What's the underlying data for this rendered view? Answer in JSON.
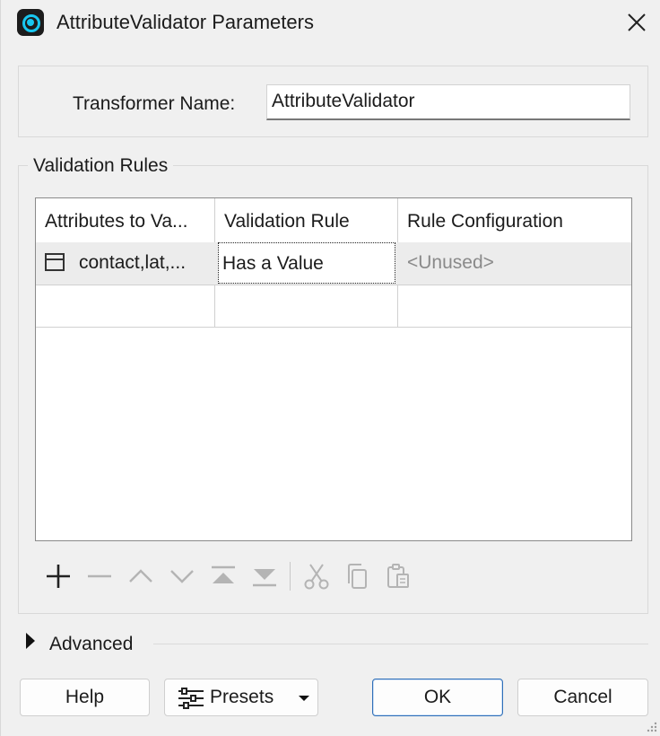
{
  "window": {
    "title": "AttributeValidator Parameters",
    "app_icon": "fme-logo-icon",
    "close_icon": "close-icon"
  },
  "transformer": {
    "label": "Transformer Name:",
    "value": "AttributeValidator"
  },
  "validation_rules": {
    "legend": "Validation Rules",
    "columns": [
      "Attributes to Va...",
      "Validation Rule",
      "Rule Configuration"
    ],
    "rows": [
      {
        "attributes": "contact,lat,...",
        "attributes_icon": "attribute-list-icon",
        "rule": "Has a Value",
        "configuration": "<Unused>"
      },
      {
        "attributes": "",
        "rule": "",
        "configuration": ""
      }
    ],
    "toolbar": [
      {
        "icon": "add-icon",
        "enabled": true
      },
      {
        "icon": "remove-icon",
        "enabled": false
      },
      {
        "icon": "move-up-icon",
        "enabled": false
      },
      {
        "icon": "move-down-icon",
        "enabled": false
      },
      {
        "icon": "move-to-top-icon",
        "enabled": false
      },
      {
        "icon": "move-to-bottom-icon",
        "enabled": false
      },
      {
        "icon": "cut-icon",
        "enabled": false
      },
      {
        "icon": "copy-icon",
        "enabled": false
      },
      {
        "icon": "paste-icon",
        "enabled": false
      }
    ]
  },
  "advanced": {
    "label": "Advanced",
    "expanded": false
  },
  "buttons": {
    "help": "Help",
    "presets": "Presets",
    "ok": "OK",
    "cancel": "Cancel"
  },
  "colors": {
    "accent": "#2f6fb8",
    "logo": "#18c7f0",
    "disabled_icon": "#b4b4b4"
  }
}
